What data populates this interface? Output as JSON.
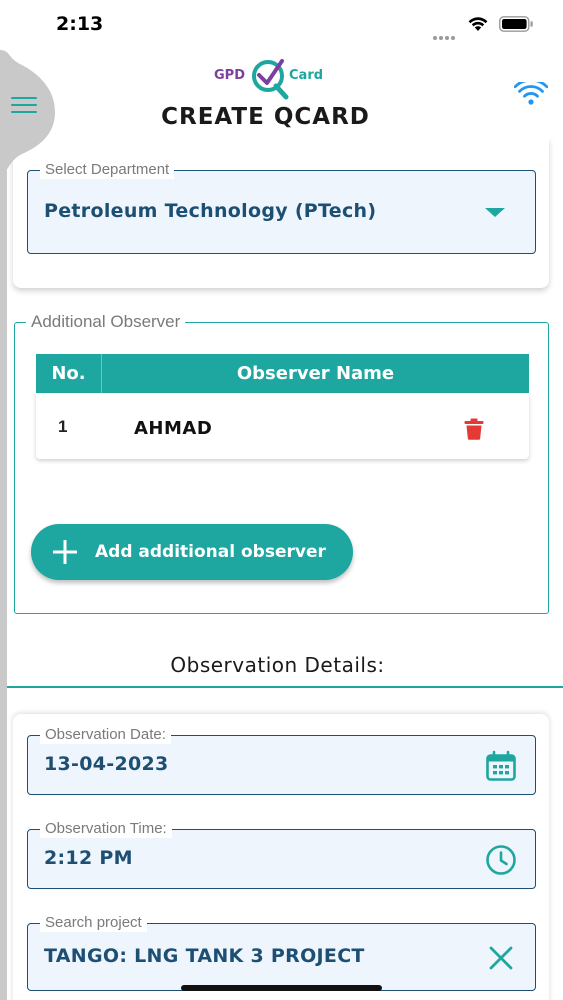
{
  "status_bar": {
    "time": "2:13"
  },
  "header": {
    "logo": {
      "left_text": "GPD",
      "right_text": "Card"
    },
    "title": "CREATE QCARD"
  },
  "department": {
    "legend": "Select Department",
    "value": "Petroleum Technology (PTech)"
  },
  "additional_observer": {
    "legend": "Additional Observer",
    "columns": [
      "No.",
      "Observer Name"
    ],
    "rows": [
      {
        "no": "1",
        "name": "AHMAD"
      }
    ],
    "add_button_label": "Add additional observer"
  },
  "observation_details": {
    "title": "Observation Details:",
    "date": {
      "legend": "Observation Date:",
      "value": "13-04-2023"
    },
    "time": {
      "legend": "Observation Time:",
      "value": "2:12 PM"
    },
    "project": {
      "legend": "Search project",
      "value": "TANGO: LNG TANK 3 PROJECT"
    }
  },
  "colors": {
    "accent": "#1ea7a0",
    "field_border": "#1d4f73",
    "field_bg": "#eef5fc",
    "delete": "#e53935",
    "logo_purple": "#7b3fa0",
    "wifi_blue": "#2196f3"
  },
  "icons": {
    "menu": "hamburger-icon",
    "wifi": "wifi-icon",
    "dropdown": "caret-down-icon",
    "delete": "trash-icon",
    "add": "plus-icon",
    "calendar": "calendar-icon",
    "clock": "clock-icon",
    "clear": "close-icon"
  }
}
